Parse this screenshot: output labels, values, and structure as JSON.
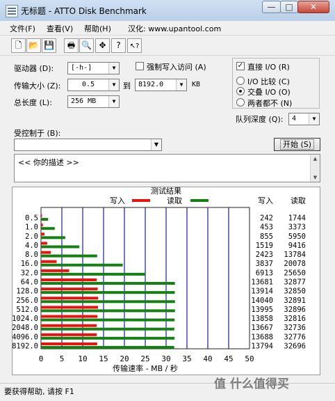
{
  "window": {
    "title": "无标题 - ATTO Disk Benchmark",
    "controls": {
      "minimize": "—",
      "maximize": "□",
      "close": "✕"
    }
  },
  "menu": [
    {
      "label": "文件(F)"
    },
    {
      "label": "查看(V)"
    },
    {
      "label": "帮助(H)"
    },
    {
      "label": "汉化: www.upantool.com"
    }
  ],
  "toolbar": {
    "buttons": [
      {
        "icon": "new-document-icon",
        "glyph": "🗋"
      },
      {
        "icon": "open-folder-icon",
        "glyph": "📂"
      },
      {
        "icon": "save-icon",
        "glyph": "💾"
      },
      {
        "icon": "print-icon",
        "glyph": "🖶"
      },
      {
        "icon": "print-preview-icon",
        "glyph": "🔍"
      },
      {
        "icon": "move-icon",
        "glyph": "✥"
      },
      {
        "icon": "about-icon",
        "glyph": "?"
      },
      {
        "icon": "context-help-icon",
        "glyph": "↖?"
      }
    ]
  },
  "settings": {
    "drive_label": "驱动器 (D):",
    "drive_value": "[-h-]",
    "transfer_size_label": "传输大小 (Z):",
    "transfer_from": "0.5",
    "to_label": "到",
    "transfer_to": "8192.0",
    "kb_unit": "KB",
    "total_length_label": "总长度 (L):",
    "total_length_value": "256 MB",
    "force_write_label": "强制写入访问 (A)",
    "force_write_checked": false,
    "direct_io_label": "直接 I/O (R)",
    "direct_io_checked": true,
    "io_compare_label": "I/O 比较 (C)",
    "overlapped_io_label": "交叠 I/O (O)",
    "neither_label": "两者都不 (N)",
    "io_mode_selected": "overlapped",
    "queue_depth_label": "队列深度 (Q):",
    "queue_depth_value": "4",
    "controlled_by_label": "受控制于 (B):",
    "controlled_by_value": "",
    "start_button": "开始 (S)",
    "description_text": "<<   你的描述    >>"
  },
  "chart_data": {
    "type": "bar",
    "title": "测试结果",
    "orientation": "horizontal",
    "categories": [
      "0.5",
      "1.0",
      "2.0",
      "4.0",
      "8.0",
      "16.0",
      "32.0",
      "64.0",
      "128.0",
      "256.0",
      "512.0",
      "1024.0",
      "2048.0",
      "4096.0",
      "8192.0"
    ],
    "series": [
      {
        "name": "写入",
        "color": "#e8120e",
        "values": [
          242,
          453,
          855,
          1519,
          2423,
          3837,
          6913,
          13681,
          13914,
          14040,
          13995,
          13858,
          13667,
          13688,
          13794
        ]
      },
      {
        "name": "读取",
        "color": "#138213",
        "values": [
          1744,
          3373,
          5950,
          9416,
          13784,
          20078,
          25650,
          32877,
          32850,
          32891,
          32896,
          32816,
          32736,
          32776,
          32696
        ]
      }
    ],
    "value_headers": [
      "写入",
      "读取"
    ],
    "xlabel": "传输速率 - MB / 秒",
    "xlim": [
      0,
      50
    ],
    "xticks": [
      0,
      5,
      10,
      15,
      20,
      25,
      30,
      35,
      40,
      45,
      50
    ],
    "grid_color": "#1a1aa0",
    "legend_placement": "top"
  },
  "status": {
    "text": "要获得帮助, 请按 F1"
  },
  "watermark": "值 什么值得买"
}
